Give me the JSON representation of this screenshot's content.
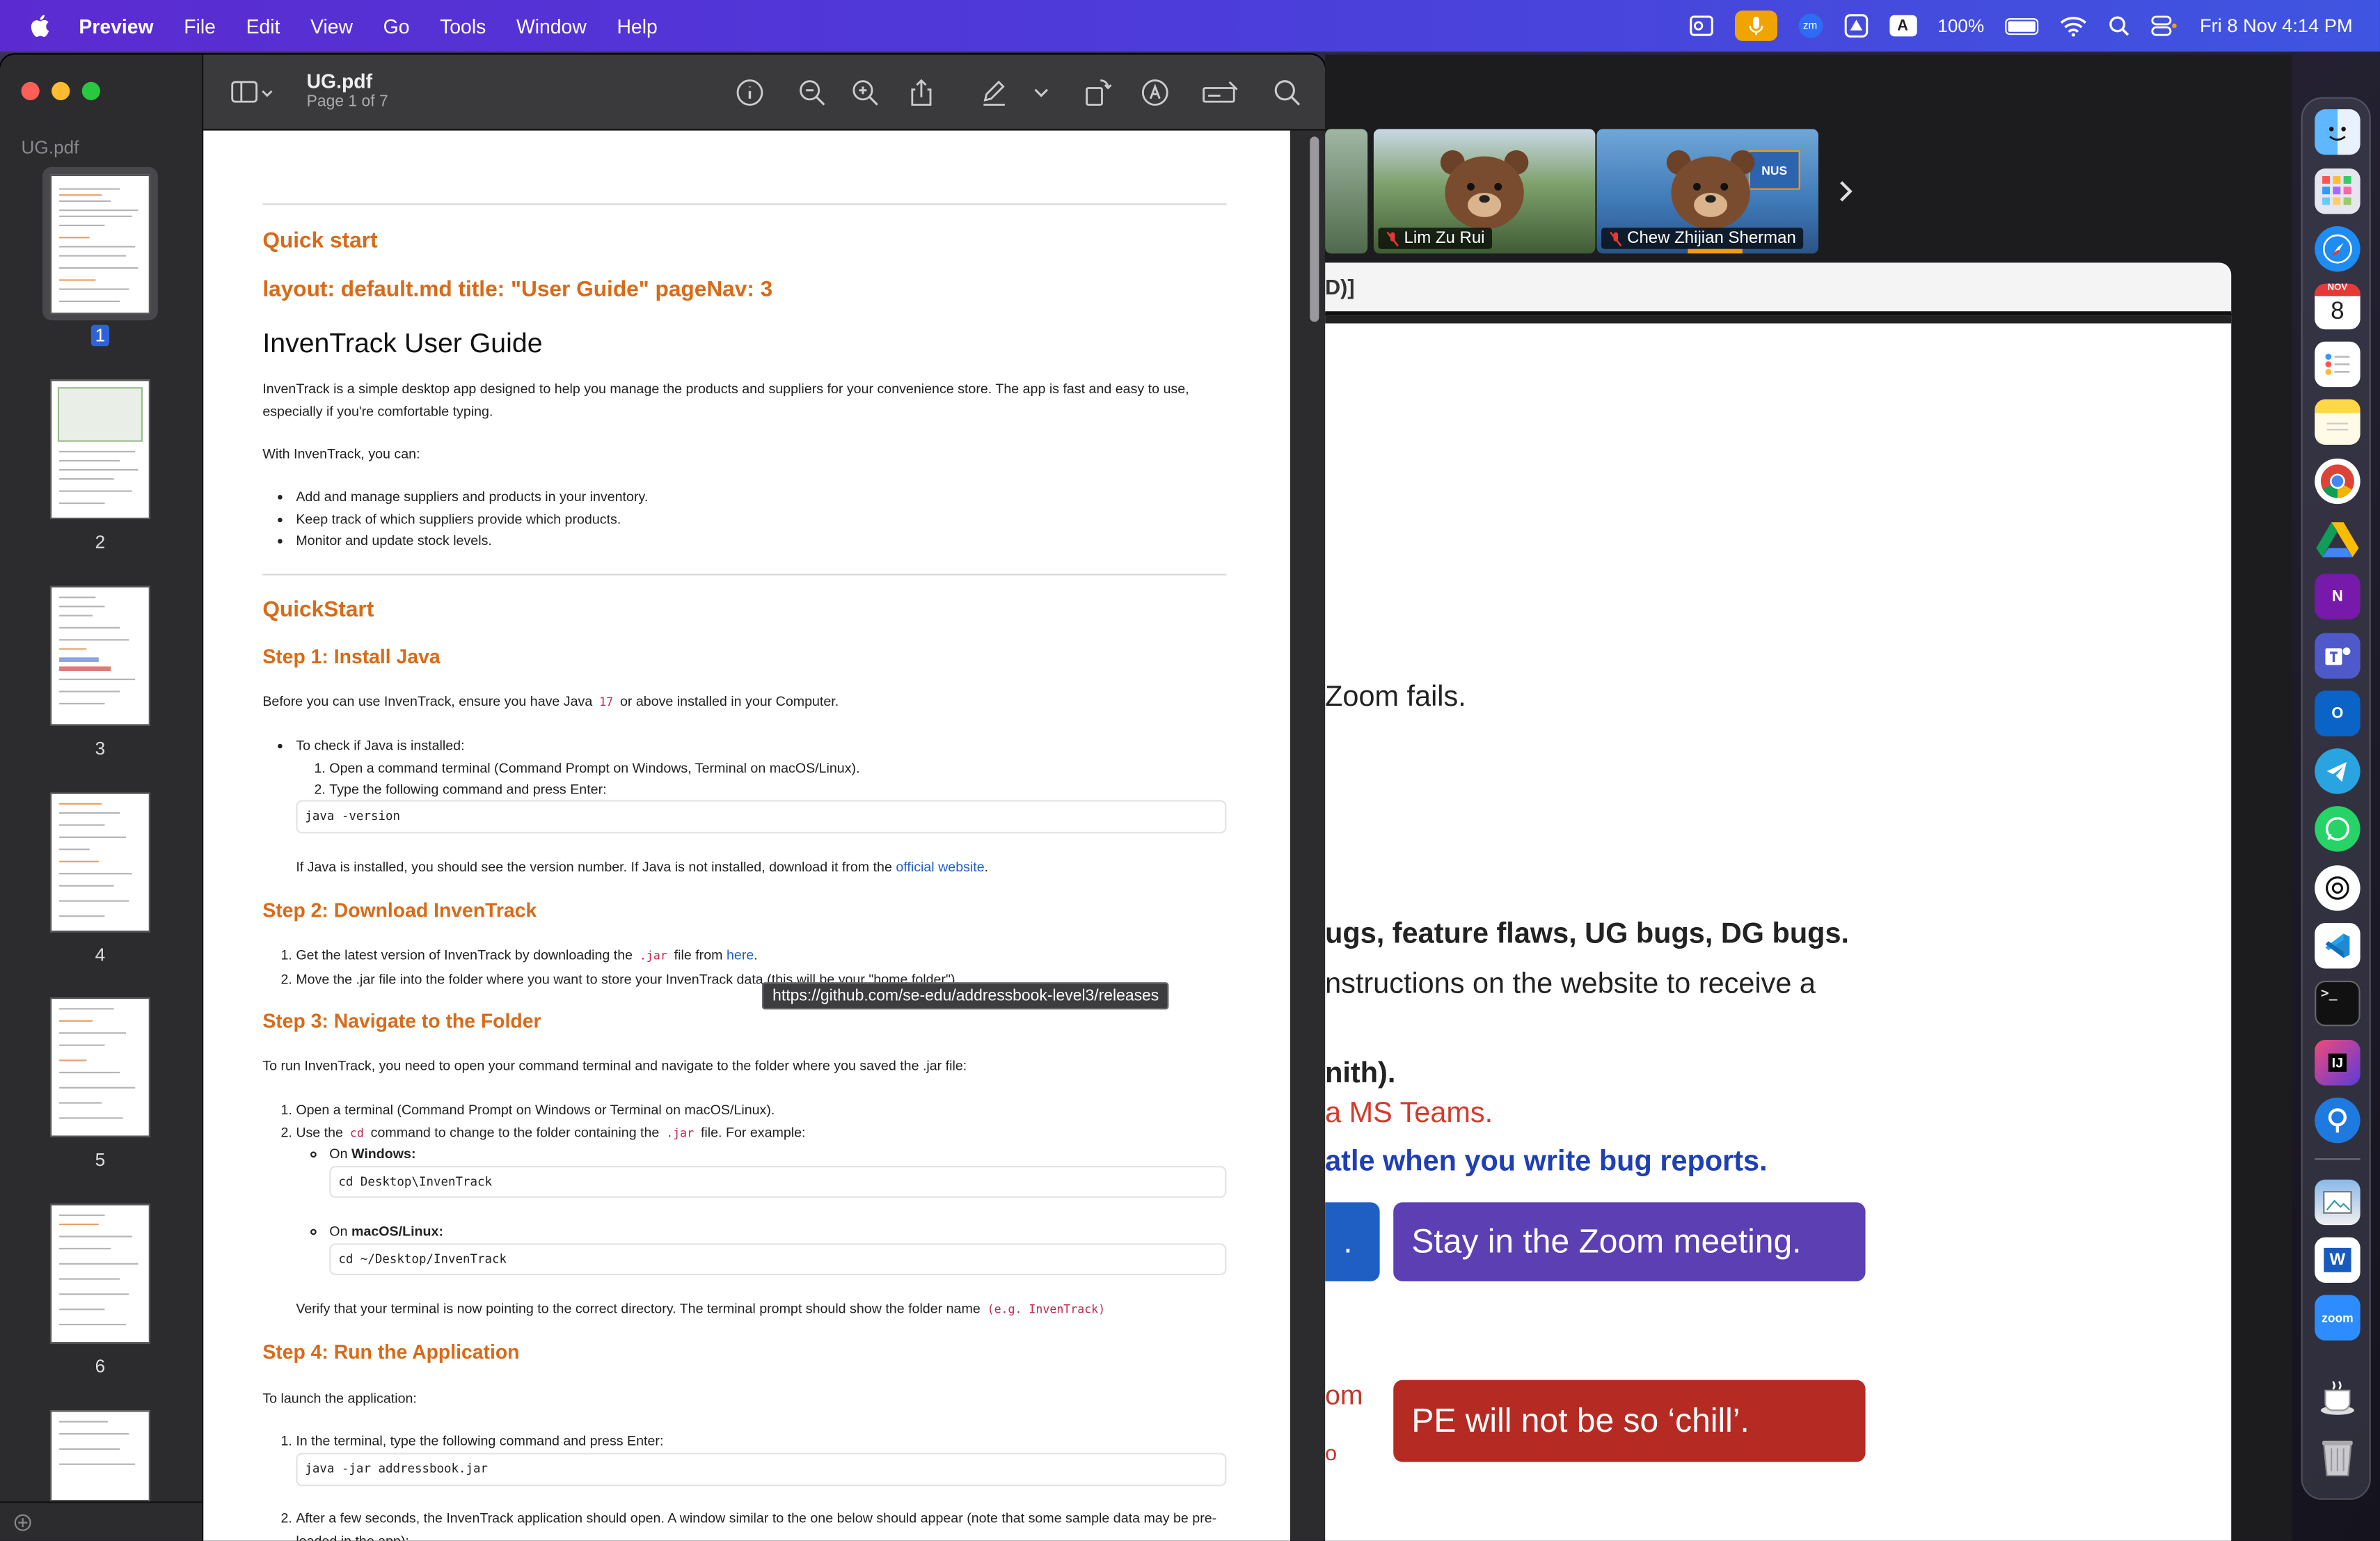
{
  "menubar": {
    "app": "Preview",
    "items": [
      "File",
      "Edit",
      "View",
      "Go",
      "Tools",
      "Window",
      "Help"
    ],
    "status": {
      "zoom_badge": "zm",
      "input_letter": "A",
      "battery": "100%",
      "datetime": "Fri 8 Nov  4:14 PM"
    }
  },
  "preview": {
    "doc_title": "UG.pdf",
    "page_status": "Page 1 of 7",
    "sidebar_title": "UG.pdf",
    "thumbnail_labels": [
      "1",
      "2",
      "3",
      "4",
      "5",
      "6"
    ],
    "tooltip": "https://github.com/se-edu/addressbook-level3/releases"
  },
  "doc": {
    "quick_start_heading": "Quick start",
    "layout_line": "layout: default.md title: \"User Guide\" pageNav: 3",
    "title": "InvenTrack User Guide",
    "intro": "InvenTrack is a simple desktop app designed to help you manage the products and suppliers for your convenience store. The app is fast and easy to use, especially if you're comfortable typing.",
    "with_line": "With InvenTrack, you can:",
    "features": [
      "Add and manage suppliers and products in your inventory.",
      "Keep track of which suppliers provide which products.",
      "Monitor and update stock levels."
    ],
    "quickstart_heading": "QuickStart",
    "step1": {
      "heading": "Step 1: Install Java",
      "text_before": "Before you can use InvenTrack, ensure you have Java",
      "java_version": "17",
      "text_after": "or above installed in your Computer.",
      "check_label": "To check if Java is installed:",
      "sub1": "Open a command terminal (Command Prompt on Windows, Terminal on macOS/Linux).",
      "sub2": "Type the following command and press Enter:",
      "command": "java -version",
      "result_before": "If Java is installed, you should see the version number. If Java is not installed, download it from the",
      "result_link": "official website",
      "result_after": "."
    },
    "step2": {
      "heading": "Step 2: Download InvenTrack",
      "item1_before": "Get the latest version of InvenTrack by downloading the",
      "item1_code": ".jar",
      "item1_mid": "file from",
      "item1_link": "here",
      "item1_after": ".",
      "item2": "Move the .jar file into the folder where you want to store your InvenTrack data (this will be your \"home folder\")."
    },
    "step3": {
      "heading": "Step 3: Navigate to the Folder",
      "intro": "To run InvenTrack, you need to open your command terminal and navigate to the folder where you saved the .jar file:",
      "item1": "Open a terminal (Command Prompt on Windows or Terminal on macOS/Linux).",
      "item2_before": "Use the",
      "item2_code1": "cd",
      "item2_mid": "command to change to the folder containing the",
      "item2_code2": ".jar",
      "item2_after": "file. For example:",
      "on": "On",
      "windows_label": "Windows:",
      "windows_cmd": "cd Desktop\\InvenTrack",
      "mac_label": "macOS/Linux:",
      "mac_cmd": "cd ~/Desktop/InvenTrack",
      "verify_text": "Verify that your terminal is now pointing to the correct directory. The terminal prompt should show the folder name",
      "verify_code": "(e.g. InvenTrack)"
    },
    "step4": {
      "heading": "Step 4: Run the Application",
      "intro": "To launch the application:",
      "item1": "In the terminal, type the following command and press Enter:",
      "command": "java -jar addressbook.jar",
      "item2": "After a few seconds, the InvenTrack application should open. A window similar to the one below should appear (note that some sample data may be pre-loaded in the app):"
    }
  },
  "zoom": {
    "participants": [
      {
        "name": "Lim Zu Rui"
      },
      {
        "name": "Chew Zhijian Sherman"
      }
    ],
    "nus_badge": "NUS",
    "slide_header_fragment": "D)]",
    "slide_lines": {
      "l1": "Zoom fails.",
      "l2": "ugs, feature flaws, UG bugs, DG bugs.",
      "l3": "nstructions on the website to receive a",
      "l4": "nith).",
      "l5": "a MS Teams.",
      "l6": "atle when you write bug reports.",
      "l7": "om",
      "l8": "o"
    },
    "pill_left": ".",
    "pill_stay": "Stay in the Zoom meeting.",
    "pill_pe": "PE will not be so ‘chill’."
  },
  "dock": {
    "calendar_month": "NOV",
    "calendar_day": "8",
    "terminal": ">_",
    "intellij": "IJ",
    "word": "W",
    "zoom": "zoom",
    "onenote": "N",
    "outlook": "O"
  },
  "colors": {
    "accent_orange": "#d96a17",
    "link_blue": "#1f5fc4",
    "slide_purple": "#5b3fb3",
    "slide_red": "#b52b23",
    "slide_blue": "#1f3fb3",
    "menubar_gradient": [
      "#5b2bd1",
      "#3f55e0"
    ]
  }
}
